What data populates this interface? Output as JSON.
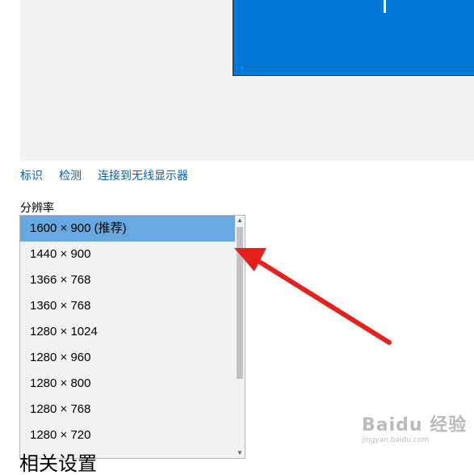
{
  "links": {
    "identify": "标识",
    "detect": "检测",
    "wireless": "连接到无线显示器"
  },
  "resolution": {
    "label": "分辨率",
    "options": [
      "1600 × 900 (推荐)",
      "1440 × 900",
      "1366 × 768",
      "1360 × 768",
      "1280 × 1024",
      "1280 × 960",
      "1280 × 800",
      "1280 × 768",
      "1280 × 720"
    ],
    "selected_index": 0
  },
  "partial_heading": "相关设置",
  "watermark": {
    "main": "Baidu 经验",
    "sub": "jingyan.baidu.com"
  },
  "colors": {
    "accent": "#0078d7",
    "selected": "#66a9e1",
    "link": "#0063b1",
    "arrow": "#e8201c"
  },
  "icons": {
    "scroll_up": "chevron-up-icon",
    "scroll_down": "chevron-down-icon",
    "annotation": "red-arrow-icon"
  }
}
